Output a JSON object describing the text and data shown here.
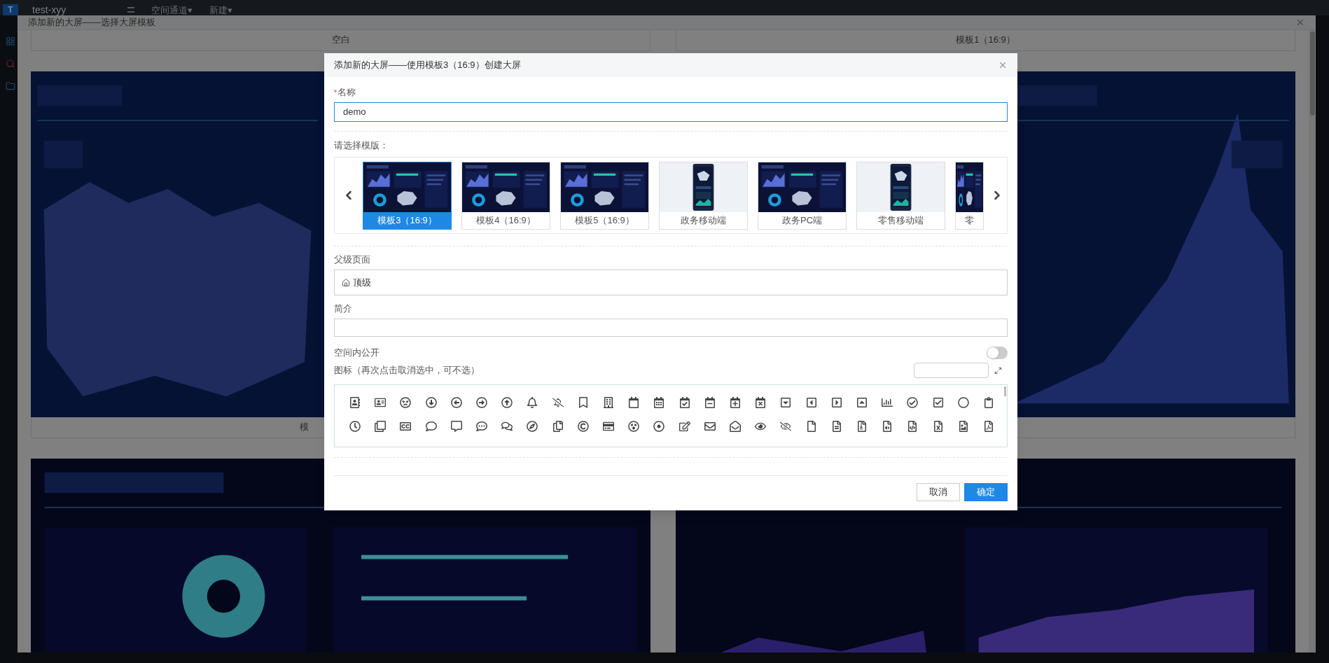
{
  "app_header": {
    "logo": "T",
    "title": "test-xyy",
    "menus": [
      {
        "label": "空间通道",
        "caret": "▾"
      },
      {
        "label": "新建",
        "caret": "▾"
      }
    ]
  },
  "background_dialog": {
    "title": "添加新的大屏——选择大屏模板",
    "top_captions": [
      "空白",
      "模板1（16:9）"
    ],
    "middle_captions": [
      "模"
    ]
  },
  "modal": {
    "title": "添加新的大屏——使用模板3（16:9）创建大屏",
    "name_field": {
      "required_mark": "*",
      "label": "名称",
      "value": "demo",
      "focused": true
    },
    "template_picker": {
      "label": "请选择模版：",
      "items": [
        {
          "caption": "模板3（16:9）",
          "selected": true,
          "kind": "dashboard"
        },
        {
          "caption": "模板4（16:9）",
          "selected": false,
          "kind": "dashboard"
        },
        {
          "caption": "模板5（16:9）",
          "selected": false,
          "kind": "dashboard"
        },
        {
          "caption": "政务移动端",
          "selected": false,
          "kind": "phone"
        },
        {
          "caption": "政务PC端",
          "selected": false,
          "kind": "dashboard"
        },
        {
          "caption": "零售移动端",
          "selected": false,
          "kind": "phone"
        },
        {
          "caption": "零",
          "selected": false,
          "kind": "dashboard"
        }
      ]
    },
    "parent_field": {
      "label": "父级页面",
      "value": "顶级"
    },
    "intro_field": {
      "label": "简介"
    },
    "public_toggle": {
      "label": "空间内公开",
      "on": false
    },
    "icon_picker": {
      "label": "图标（再次点击取消选中，可不选）"
    },
    "buttons": [
      {
        "label": "取消",
        "kind": "secondary"
      },
      {
        "label": "确定",
        "kind": "primary"
      }
    ]
  }
}
